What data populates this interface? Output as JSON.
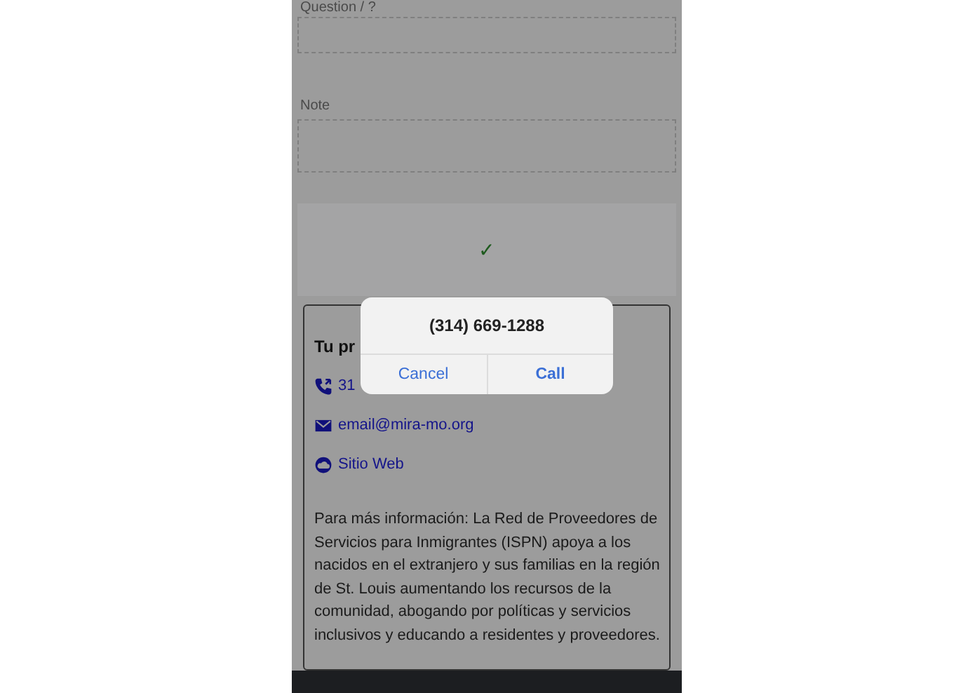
{
  "form": {
    "fields": [
      {
        "label": "Question / ?"
      },
      {
        "label": "Note"
      }
    ]
  },
  "submit_button": {
    "icon": "✓"
  },
  "contact_card": {
    "title": "Tu pr",
    "links": [
      {
        "kind": "phone",
        "text": "31"
      },
      {
        "kind": "email",
        "text": "email@mira-mo.org"
      },
      {
        "kind": "web",
        "text": "Sitio Web"
      }
    ],
    "description": "Para más información: La Red de Proveedores de Servicios para Inmigrantes (ISPN) apoya a los nacidos en el extranjero y sus familias en la región de St. Louis aumentando los recursos de la comunidad, abogando por políticas y servicios inclusivos y educando a residentes y proveedores."
  },
  "dialog": {
    "title": "(314) 669-1288",
    "buttons": [
      {
        "label": "Cancel",
        "kind": "cancel"
      },
      {
        "label": "Call",
        "kind": "default"
      }
    ]
  }
}
